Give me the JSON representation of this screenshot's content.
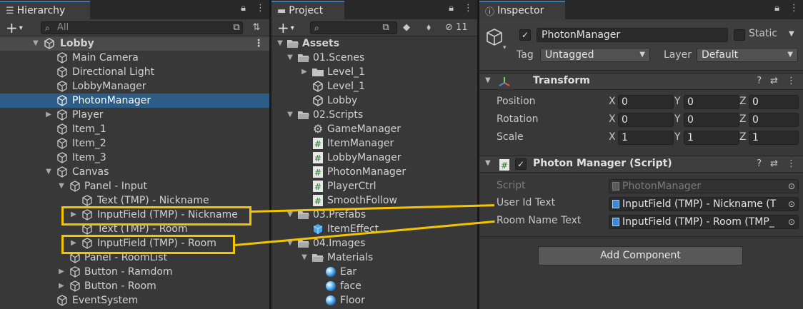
{
  "hierarchy": {
    "tab_title": "Hierarchy",
    "search_placeholder": "All",
    "scene": "Lobby",
    "items": [
      {
        "label": "Main Camera"
      },
      {
        "label": "Directional Light"
      },
      {
        "label": "LobbyManager"
      },
      {
        "label": "PhotonManager"
      },
      {
        "label": "Player"
      },
      {
        "label": "Item_1"
      },
      {
        "label": "Item_2"
      },
      {
        "label": "Item_3"
      },
      {
        "label": "Canvas"
      },
      {
        "label": "Panel - Input"
      },
      {
        "label": "Text (TMP) - Nickname"
      },
      {
        "label": "InputField (TMP) - Nickname"
      },
      {
        "label": "Text (TMP) - Room"
      },
      {
        "label": "InputField (TMP) - Room"
      },
      {
        "label": "Panel - RoomList"
      },
      {
        "label": "Button - Ramdom"
      },
      {
        "label": "Button - Room"
      },
      {
        "label": "EventSystem"
      }
    ]
  },
  "project": {
    "tab_title": "Project",
    "hidden_count": "11",
    "items": [
      {
        "label": "Assets"
      },
      {
        "label": "01.Scenes"
      },
      {
        "label": "Level_1"
      },
      {
        "label": "Level_1"
      },
      {
        "label": "Lobby"
      },
      {
        "label": "02.Scripts"
      },
      {
        "label": "GameManager"
      },
      {
        "label": "ItemManager"
      },
      {
        "label": "LobbyManager"
      },
      {
        "label": "PhotonManager"
      },
      {
        "label": "PlayerCtrl"
      },
      {
        "label": "SmoothFollow"
      },
      {
        "label": "03.Prefabs"
      },
      {
        "label": "ItemEffect"
      },
      {
        "label": "04.Images"
      },
      {
        "label": "Materials"
      },
      {
        "label": "Ear"
      },
      {
        "label": "face"
      },
      {
        "label": "Floor"
      }
    ]
  },
  "inspector": {
    "tab_title": "Inspector",
    "object_name": "PhotonManager",
    "static_label": "Static",
    "tag_label": "Tag",
    "tag_value": "Untagged",
    "layer_label": "Layer",
    "layer_value": "Default",
    "transform": {
      "title": "Transform",
      "position": {
        "label": "Position",
        "x": "0",
        "y": "0",
        "z": "0"
      },
      "rotation": {
        "label": "Rotation",
        "x": "0",
        "y": "0",
        "z": "0"
      },
      "scale": {
        "label": "Scale",
        "x": "1",
        "y": "1",
        "z": "1"
      }
    },
    "script_component": {
      "title": "Photon Manager (Script)",
      "script_label": "Script",
      "script_value": "PhotonManager",
      "user_id_label": "User Id Text",
      "user_id_value": "InputField (TMP) - Nickname (T",
      "room_name_label": "Room Name Text",
      "room_name_value": "InputField (TMP) - Room (TMP_"
    },
    "add_component": "Add Component"
  },
  "axis_labels": {
    "x": "X",
    "y": "Y",
    "z": "Z"
  },
  "colors": {
    "highlight": "#f5c400",
    "selection": "#2c5d87",
    "tab_accent": "#3a78b8"
  }
}
